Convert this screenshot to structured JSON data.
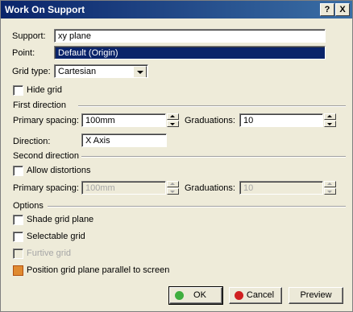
{
  "window": {
    "title": "Work On Support",
    "help_label": "?",
    "close_label": "X"
  },
  "support": {
    "label": "Support:",
    "value": "xy plane"
  },
  "point": {
    "label": "Point:",
    "value": "Default (Origin)"
  },
  "grid_type": {
    "label": "Grid type:",
    "value": "Cartesian"
  },
  "hide_grid": {
    "label": "Hide grid"
  },
  "first_direction": {
    "title": "First direction",
    "primary_spacing_label": "Primary spacing:",
    "primary_spacing_value": "100mm",
    "graduations_label": "Graduations:",
    "graduations_value": "10",
    "direction_label": "Direction:",
    "direction_value": "X Axis"
  },
  "second_direction": {
    "title": "Second direction",
    "allow_distortions_label": "Allow distortions",
    "primary_spacing_label": "Primary spacing:",
    "primary_spacing_value": "100mm",
    "graduations_label": "Graduations:",
    "graduations_value": "10"
  },
  "options": {
    "title": "Options",
    "shade_grid_plane": "Shade grid plane",
    "selectable_grid": "Selectable grid",
    "furtive_grid": "Furtive grid",
    "position_parallel": "Position grid plane parallel to screen"
  },
  "buttons": {
    "ok": "OK",
    "cancel": "Cancel",
    "preview": "Preview"
  },
  "colors": {
    "title_bar": "#0a246a",
    "dialog_bg": "#eeebd9",
    "ok_dot": "#3fae3f",
    "cancel_dot": "#d02020"
  }
}
